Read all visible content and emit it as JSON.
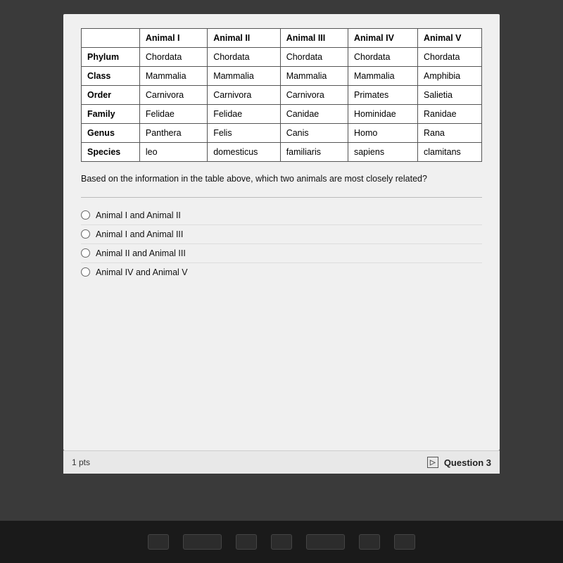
{
  "table": {
    "headers": [
      "",
      "Animal I",
      "Animal II",
      "Animal III",
      "Animal IV",
      "Animal V"
    ],
    "rows": [
      {
        "label": "Phylum",
        "cells": [
          "Chordata",
          "Chordata",
          "Chordata",
          "Chordata",
          "Chordata"
        ]
      },
      {
        "label": "Class",
        "cells": [
          "Mammalia",
          "Mammalia",
          "Mammalia",
          "Mammalia",
          "Amphibia"
        ]
      },
      {
        "label": "Order",
        "cells": [
          "Carnivora",
          "Carnivora",
          "Carnivora",
          "Primates",
          "Salietia"
        ]
      },
      {
        "label": "Family",
        "cells": [
          "Felidae",
          "Felidae",
          "Canidae",
          "Hominidae",
          "Ranidae"
        ]
      },
      {
        "label": "Genus",
        "cells": [
          "Panthera",
          "Felis",
          "Canis",
          "Homo",
          "Rana"
        ]
      },
      {
        "label": "Species",
        "cells": [
          "leo",
          "domesticus",
          "familiaris",
          "sapiens",
          "clamitans"
        ]
      }
    ]
  },
  "question": {
    "text": "Based on the information in the table above, which two animals are most closely related?",
    "options": [
      "Animal I and Animal II",
      "Animal I and Animal III",
      "Animal II and Animal III",
      "Animal IV and Animal V"
    ]
  },
  "footer": {
    "pts": "1 pts",
    "question_label": "Question 3"
  }
}
